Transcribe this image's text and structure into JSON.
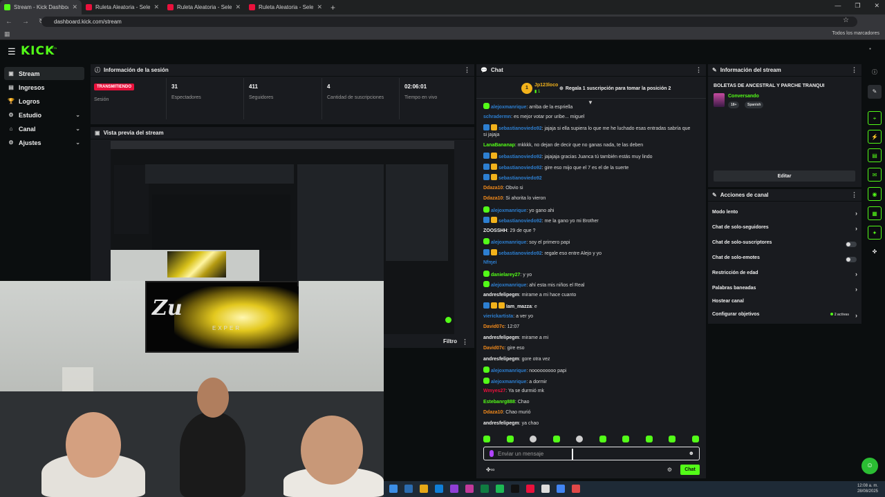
{
  "browser": {
    "tabs": [
      {
        "title": "Stream - Kick Dashboard",
        "active": true,
        "color": "#53fc18"
      },
      {
        "title": "Ruleta Aleatoria - Selector Pers",
        "active": false,
        "color": "#e9113c"
      },
      {
        "title": "Ruleta Aleatoria - Selector Pers",
        "active": false,
        "color": "#e9113c"
      },
      {
        "title": "Ruleta Aleatoria - Selector Pers",
        "active": false,
        "color": "#e9113c"
      }
    ],
    "new_tab": "+",
    "url": "dashboard.kick.com/stream",
    "bookmarks_all": "Todos los marcadores"
  },
  "kick": {
    "logo": "KICK",
    "beta": "BETA",
    "brand_color": "#53fc18"
  },
  "sidebar": {
    "items": [
      {
        "label": "Stream",
        "icon": "stream-icon",
        "glyph": "▣",
        "active": true,
        "expand": false
      },
      {
        "label": "Ingresos",
        "icon": "revenue-icon",
        "glyph": "▤",
        "active": false,
        "expand": false
      },
      {
        "label": "Logros",
        "icon": "trophy-icon",
        "glyph": "🏆",
        "active": false,
        "expand": false
      },
      {
        "label": "Estudio",
        "icon": "studio-icon",
        "glyph": "⚙",
        "active": false,
        "expand": true
      },
      {
        "label": "Canal",
        "icon": "channel-icon",
        "glyph": "⌂",
        "active": false,
        "expand": true
      },
      {
        "label": "Ajustes",
        "icon": "settings-icon",
        "glyph": "⚙",
        "active": false,
        "expand": true
      }
    ]
  },
  "session": {
    "title": "Información de la sesión",
    "live_badge": "TRANSMITIENDO",
    "live_label": "Sesión",
    "stats": [
      {
        "value": "31",
        "label": "Espectadores"
      },
      {
        "value": "411",
        "label": "Seguidores"
      },
      {
        "value": "4",
        "label": "Cantidad de suscripciones"
      },
      {
        "value": "02:06:01",
        "label": "Tiempo en vivo"
      }
    ]
  },
  "preview": {
    "title": "Vista previa del stream",
    "tv_text": "Zu",
    "tv_sub": "EXPER"
  },
  "filter": {
    "label": "Filtro"
  },
  "chat": {
    "title": "Chat",
    "pinned": {
      "user": "Jp123loco",
      "count": "1",
      "message": "Regala 1 suscripción para tomar la posición 2"
    },
    "messages": [
      {
        "user": "alejoxmanrique",
        "color": "#2d7fd1",
        "text": "arriba de la espriella",
        "badges": [
          "green"
        ]
      },
      {
        "user": "schradermn",
        "color": "#2d7fd1",
        "text": "es mejor votar por uribe... miguel",
        "badges": []
      },
      {
        "user": "sebastianoviedo92",
        "color": "#2d7fd1",
        "text": "jajaja si ella supiera lo que me he luchado esas entradas sabría que si jajaja",
        "badges": [
          "blue",
          "gold"
        ]
      },
      {
        "user": "LanaBananap",
        "color": "#53fc18",
        "text": "mkkkk, no dejan de decir que no ganas nada, te las deben",
        "badges": []
      },
      {
        "user": "sebastianoviedo92",
        "color": "#2d7fd1",
        "text": "jajajaja gracias Juanca tú también estás muy lindo",
        "badges": [
          "blue",
          "gold"
        ]
      },
      {
        "user": "sebastianoviedo92",
        "color": "#2d7fd1",
        "text": "gire eso mijo que el 7 es el de la suerte",
        "badges": [
          "blue",
          "gold"
        ]
      },
      {
        "user": "sebastianoviedo92",
        "color": "#2d7fd1",
        "text": "",
        "badges": [
          "blue",
          "gold"
        ]
      },
      {
        "user": "Ddaza10",
        "color": "#f28a1b",
        "text": "Obvio si",
        "badges": []
      },
      {
        "user": "Ddaza10",
        "color": "#f28a1b",
        "text": "Si ahorita lo vieron",
        "badges": []
      },
      {
        "user": "alejoxmanrique",
        "color": "#2d7fd1",
        "text": "yo gano ahi",
        "badges": [
          "green"
        ]
      },
      {
        "user": "sebastianoviedo92",
        "color": "#2d7fd1",
        "text": "me la gano yo mi Brother",
        "badges": [
          "blue",
          "gold"
        ]
      },
      {
        "user": "ZOOSSHH",
        "color": "#eeeeee",
        "text": "29 de que ?",
        "badges": []
      },
      {
        "user": "alejoxmanrique",
        "color": "#2d7fd1",
        "text": "soy el primero papi",
        "badges": [
          "green"
        ]
      },
      {
        "user": "sebastianoviedo92",
        "color": "#2d7fd1",
        "text": "regale eso entre Alejo y yo",
        "badges": [
          "blue",
          "gold"
        ]
      },
      {
        "user": "Nfɱei",
        "color": "#2d7fd1",
        "text": "",
        "badges": []
      },
      {
        "user": "danielarey27",
        "color": "#53fc18",
        "text": "y yo",
        "badges": [
          "green"
        ]
      },
      {
        "user": "alejoxmanrique",
        "color": "#2d7fd1",
        "text": "ahí esta mis niños el Real",
        "badges": [
          "green"
        ]
      },
      {
        "user": "andresfelipegm",
        "color": "#eeeeee",
        "text": "mirame a mi hace cuanto",
        "badges": []
      },
      {
        "user": "Iam_mazza",
        "color": "#eeeeee",
        "text": "e",
        "badges": [
          "blue",
          "gold",
          "gold"
        ]
      },
      {
        "user": "vierickartista",
        "color": "#2d7fd1",
        "text": "a ver yo",
        "badges": []
      },
      {
        "user": "David07c",
        "color": "#f28a1b",
        "text": "12:07",
        "badges": []
      },
      {
        "user": "andresfelipegm",
        "color": "#eeeeee",
        "text": "mirame a mi",
        "badges": []
      },
      {
        "user": "David07c",
        "color": "#f28a1b",
        "text": "gire eso",
        "badges": []
      },
      {
        "user": "andresfelipegm",
        "color": "#eeeeee",
        "text": "gore otra vez",
        "badges": []
      },
      {
        "user": "alejoxmanrique",
        "color": "#2d7fd1",
        "text": "nooooooooo papi",
        "badges": [
          "green"
        ]
      },
      {
        "user": "alejoxmanrique",
        "color": "#2d7fd1",
        "text": "a dormir",
        "badges": [
          "green"
        ]
      },
      {
        "user": "Wmyes27",
        "color": "#e9113c",
        "text": "Ya se durmió mk",
        "badges": []
      },
      {
        "user": "Estebanrg888",
        "color": "#53fc18",
        "text": "Chao",
        "badges": []
      },
      {
        "user": "Ddaza10",
        "color": "#f28a1b",
        "text": "Chao murió",
        "badges": []
      },
      {
        "user": "andresfelipegm",
        "color": "#eeeeee",
        "text": "ya chao",
        "badges": []
      }
    ],
    "input_placeholder": "Enviar un mensaje",
    "send_label": "Chat"
  },
  "stream_info": {
    "title": "Información del stream",
    "stream_title": "BOLETAS DE ANCESTRAL Y PARCHE TRANQUI",
    "category": "Conversando",
    "tags": [
      "18+",
      "Spanish"
    ],
    "edit_label": "Editar"
  },
  "channel_actions": {
    "title": "Acciones de canal",
    "items": [
      {
        "label": "Modo lento",
        "type": "arrow"
      },
      {
        "label": "Chat de solo-seguidores",
        "type": "arrow"
      },
      {
        "label": "Chat de solo-suscriptores",
        "type": "toggle"
      },
      {
        "label": "Chat de solo-emotes",
        "type": "toggle"
      },
      {
        "label": "Restricción de edad",
        "type": "arrow"
      },
      {
        "label": "Palabras baneadas",
        "type": "arrow"
      },
      {
        "label": "Hostear canal",
        "type": "none"
      },
      {
        "label": "Configurar objetivos",
        "type": "arrow",
        "extra": "2 activas"
      }
    ]
  },
  "taskbar": {
    "time": "12:08 a. m.",
    "date": "28/08/2025"
  }
}
